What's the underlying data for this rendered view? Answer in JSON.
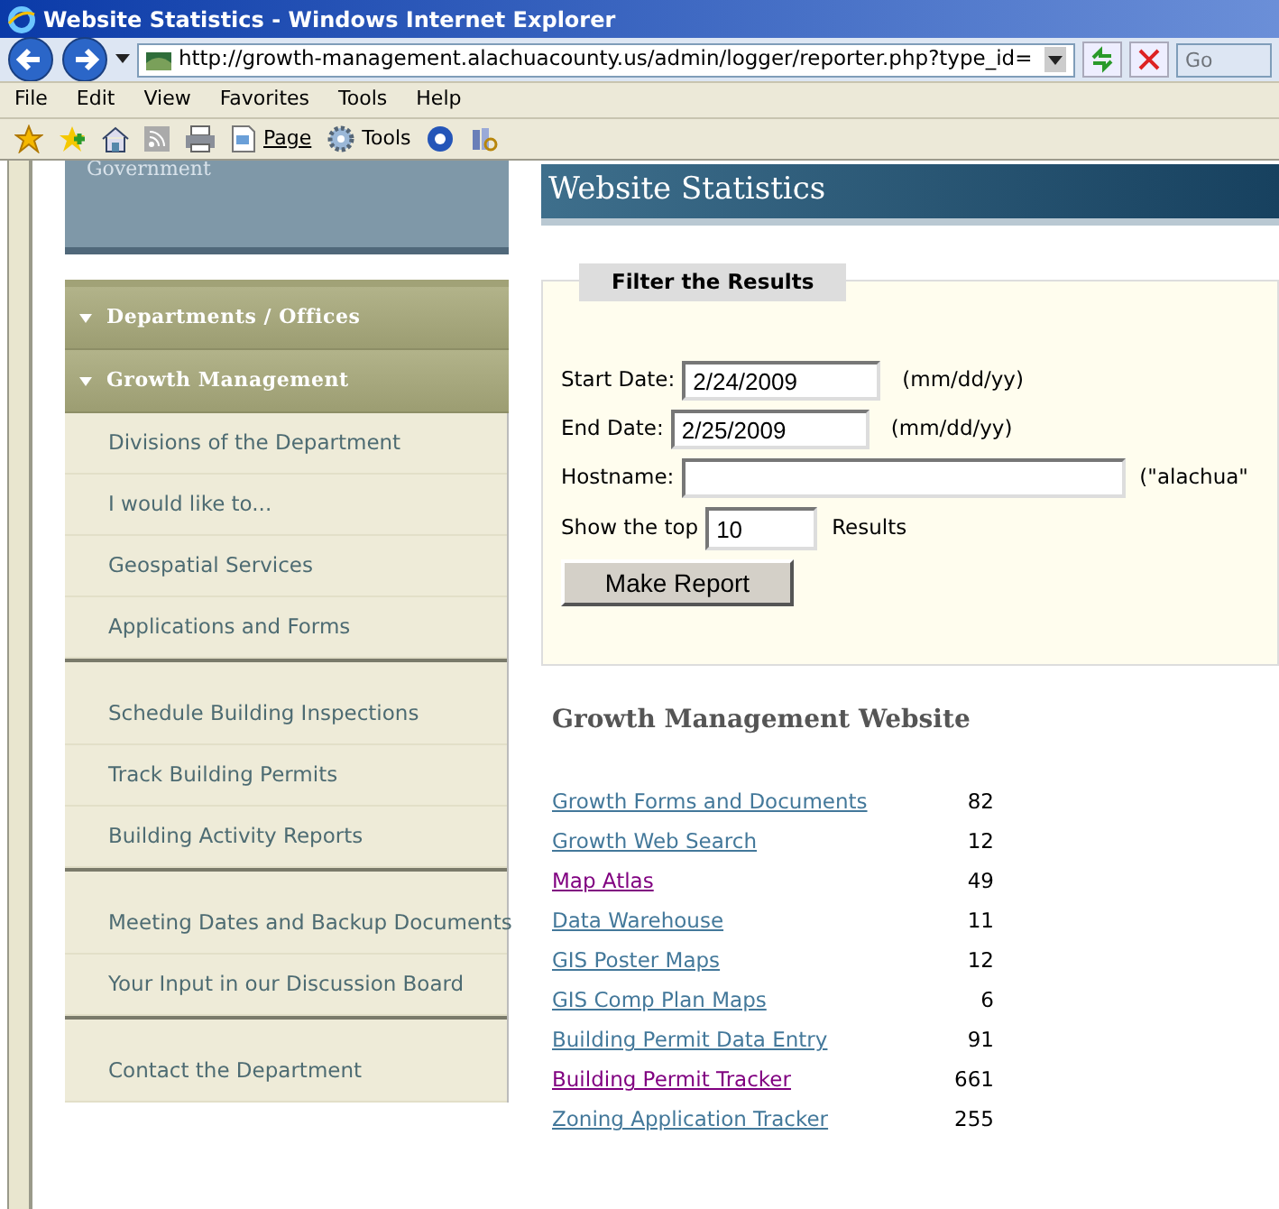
{
  "window": {
    "title": "Website Statistics - Windows Internet Explorer"
  },
  "address_bar": {
    "url": "http://growth-management.alachuacounty.us/admin/logger/reporter.php?type_id=",
    "search_placeholder": "Go"
  },
  "menu": [
    "File",
    "Edit",
    "View",
    "Favorites",
    "Tools",
    "Help"
  ],
  "command_bar": [
    "Page",
    "Tools"
  ],
  "sidebar": {
    "top_block": "Government",
    "sections": [
      {
        "label": "Departments / Offices",
        "expanded": true
      },
      {
        "label": "Growth Management",
        "expanded": true
      }
    ],
    "groups": [
      [
        "Divisions of the Department",
        "I would like to...",
        "Geospatial Services",
        "Applications and Forms"
      ],
      [
        "Schedule Building Inspections",
        "Track Building Permits",
        "Building Activity Reports"
      ],
      [
        "Meeting Dates and Backup Documents",
        "Your Input in our Discussion Board"
      ],
      [
        "Contact the Department"
      ]
    ]
  },
  "page": {
    "title": "Website Statistics",
    "filter": {
      "legend": "Filter the Results",
      "start_label": "Start Date:",
      "start_value": "2/24/2009",
      "start_hint": "(mm/dd/yy)",
      "end_label": "End Date:",
      "end_value": "2/25/2009",
      "end_hint": "(mm/dd/yy)",
      "host_label": "Hostname:",
      "host_hint": "(\"alachua\"",
      "top_label": "Show the top",
      "top_value": "10",
      "top_suffix": "Results",
      "button": "Make Report"
    },
    "results_title": "Growth Management Website",
    "results": [
      {
        "name": "Growth Forms and Documents",
        "count": "82",
        "visited": false
      },
      {
        "name": "Growth Web Search",
        "count": "12",
        "visited": false
      },
      {
        "name": "Map Atlas",
        "count": "49",
        "visited": true
      },
      {
        "name": "Data Warehouse",
        "count": "11",
        "visited": false
      },
      {
        "name": "GIS Poster Maps",
        "count": "12",
        "visited": false
      },
      {
        "name": "GIS Comp Plan Maps",
        "count": "6",
        "visited": false
      },
      {
        "name": "Building Permit Data Entry",
        "count": "91",
        "visited": false
      },
      {
        "name": "Building Permit Tracker",
        "count": "661",
        "visited": true
      },
      {
        "name": "Zoning Application Tracker",
        "count": "255",
        "visited": false
      }
    ]
  }
}
